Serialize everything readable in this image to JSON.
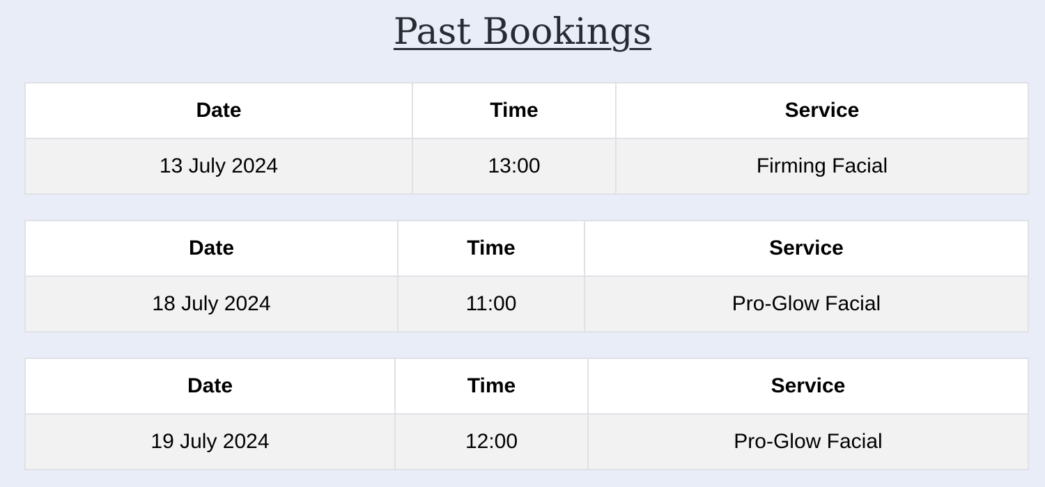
{
  "page": {
    "title": "Past Bookings"
  },
  "columns": {
    "date": "Date",
    "time": "Time",
    "service": "Service"
  },
  "bookings": [
    {
      "date": "13 July 2024",
      "time": "13:00",
      "service": "Firming Facial"
    },
    {
      "date": "18 July 2024",
      "time": "11:00",
      "service": "Pro-Glow Facial"
    },
    {
      "date": "19 July 2024",
      "time": "12:00",
      "service": "Pro-Glow Facial"
    }
  ],
  "colors": {
    "background": "#e9edf8",
    "header_background": "#ffffff",
    "row_background": "#f2f2f2",
    "border": "#dfe1e6",
    "title": "#272b33"
  }
}
